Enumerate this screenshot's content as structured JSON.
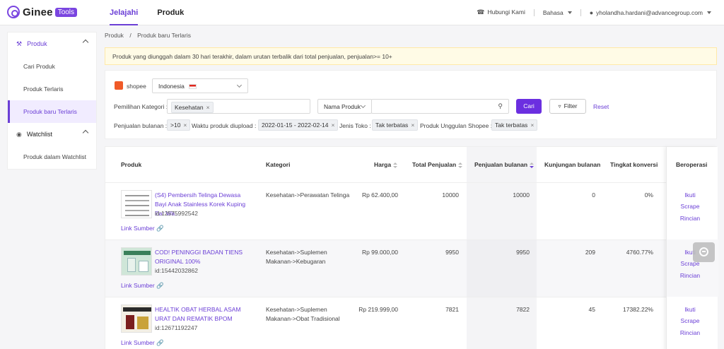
{
  "header": {
    "logo_text": "Ginee",
    "logo_badge": "Tools",
    "nav": [
      "Jelajahi",
      "Produk"
    ],
    "contact": "Hubungi Kami",
    "language": "Bahasa",
    "user_email": "yholandha.hardani@advancegroup.com"
  },
  "sidebar": {
    "group_produk": "Produk",
    "items_produk": [
      "Cari Produk",
      "Produk Terlaris",
      "Produk baru Terlaris"
    ],
    "group_watchlist": "Watchlist",
    "items_watchlist": [
      "Produk dalam Watchlist"
    ]
  },
  "breadcrumb": {
    "root": "Produk",
    "sep": "/",
    "current": "Produk baru Terlaris"
  },
  "notice": "Produk yang diunggah dalam 30 hari terakhir, dalam urutan terbalik dari total penjualan, penjualan>= 10+",
  "filters": {
    "platform": "shopee",
    "country": "Indonesia",
    "category_label": "Pemilihan Kategori :",
    "category_tag": "Kesehatan",
    "search_field": "Nama Produk",
    "search_button": "Cari",
    "filter_button": "Filter",
    "reset_link": "Reset",
    "monthly_sales_label": "Penjualan bulanan :",
    "monthly_sales_tag": ">10",
    "upload_time_label": "Waktu produk diupload :",
    "upload_time_tag": "2022-01-15 - 2022-02-14",
    "shop_type_label": "Jenis Toko :",
    "shop_type_tag": "Tak terbatas",
    "featured_label": "Produk Unggulan Shopee :",
    "featured_tag": "Tak terbatas"
  },
  "table": {
    "headers": {
      "product": "Produk",
      "category": "Kategori",
      "price": "Harga",
      "total_sales": "Total Penjualan",
      "monthly_sales": "Penjualan bulanan",
      "monthly_visits": "Kunjungan bulanan",
      "conversion": "Tingkat konversi",
      "operate": "Beroperasi"
    },
    "source_link": "Link Sumber",
    "ops": [
      "Ikuti",
      "Scrape",
      "Rincian"
    ],
    "rows": [
      {
        "name": "(S4) Pembersih Telinga Dewasa Bayi Anak Stainless Korek Kuping Ear Wa...",
        "id": "id:12575992542",
        "category": "Kesehatan->Perawatan Telinga",
        "price": "Rp 62.400,00",
        "total_sales": "10000",
        "monthly_sales": "10000",
        "visits": "0",
        "conversion": "0%"
      },
      {
        "name": "COD! PENINGGI BADAN TIENS ORIGINAL 100%",
        "id": "id:15442032862",
        "category": "Kesehatan->Suplemen Makanan->Kebugaran",
        "price": "Rp 99.000,00",
        "total_sales": "9950",
        "monthly_sales": "9950",
        "visits": "209",
        "conversion": "4760.77%"
      },
      {
        "name": "HEALTIK OBAT HERBAL ASAM URAT DAN REMATIK BPOM",
        "id": "id:12671192247",
        "category": "Kesehatan->Suplemen Makanan->Obat Tradisional",
        "price": "Rp 219.999,00",
        "total_sales": "7821",
        "monthly_sales": "7822",
        "visits": "45",
        "conversion": "17382.22%"
      }
    ]
  },
  "colors": {
    "accent": "#6b3fd6",
    "notice_bg": "#fffbe6"
  }
}
